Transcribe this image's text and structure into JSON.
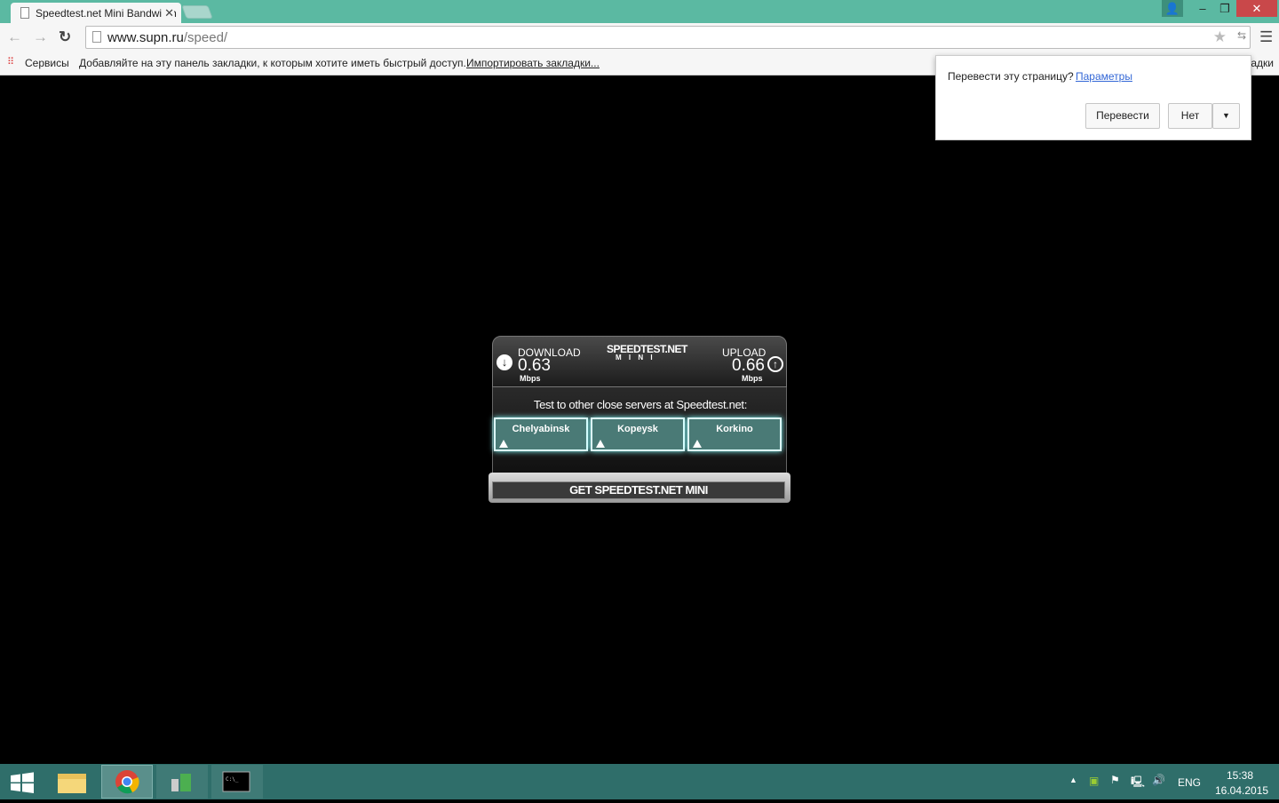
{
  "browser": {
    "tab_title": "Speedtest.net Mini Bandwidth",
    "url_host": "www.supn.ru",
    "url_path": "/speed/",
    "bookmarks": {
      "apps": "Сервисы",
      "hint": "Добавляйте на эту панель закладки, к которым хотите иметь быстрый доступ.",
      "import": "Импортировать закладки...",
      "other": "Другие закладки"
    }
  },
  "translate_popup": {
    "question": "Перевести эту страницу?",
    "options": "Параметры",
    "translate": "Перевести",
    "no": "Нет"
  },
  "speedtest": {
    "download_label": "DOWNLOAD",
    "download_value": "0.63",
    "download_unit": "Mbps",
    "upload_label": "UPLOAD",
    "upload_value": "0.66",
    "upload_unit": "Mbps",
    "logo": "SPEEDTEST.NET",
    "logo_sub": "M I N I",
    "servers_heading": "Test to other close servers at Speedtest.net:",
    "servers": [
      "Chelyabinsk",
      "Kopeysk",
      "Korkino"
    ],
    "get_button": "GET SPEEDTEST.NET MINI"
  },
  "taskbar": {
    "lang": "ENG",
    "time": "15:38",
    "date": "16.04.2015"
  }
}
